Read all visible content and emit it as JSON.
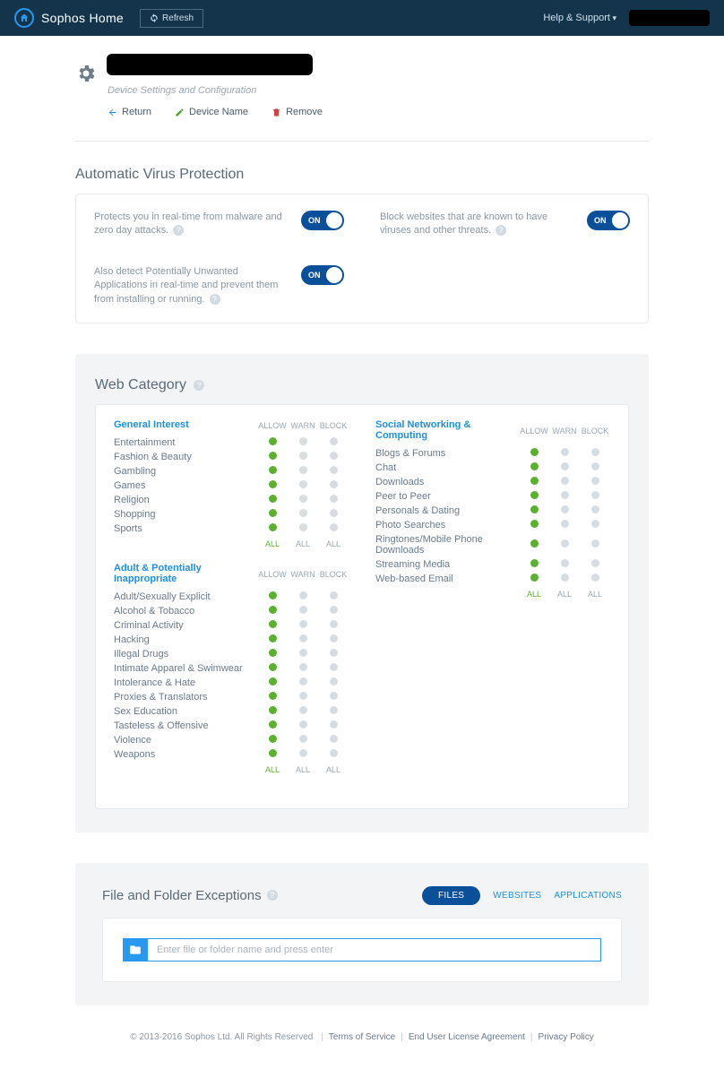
{
  "topbar": {
    "product": "Sophos Home",
    "refresh": "Refresh",
    "help": "Help & Support"
  },
  "device": {
    "subcaption": "Device Settings and Configuration",
    "return": "Return",
    "rename": "Device Name",
    "remove": "Remove"
  },
  "avp": {
    "title": "Automatic Virus Protection",
    "on_label": "ON",
    "items": [
      {
        "text": "Protects you in real-time from malware and zero day attacks."
      },
      {
        "text": "Block websites that are known to have viruses and other threats."
      },
      {
        "text": "Also detect Potentially Unwanted Applications in real-time and prevent them from installing or running."
      }
    ]
  },
  "webcat": {
    "title": "Web Category",
    "col_headers": {
      "allow": "ALLOW",
      "warn": "WARN",
      "block": "BLOCK"
    },
    "all_label": "ALL",
    "left_groups": [
      {
        "name": "General Interest",
        "rows": [
          "Entertainment",
          "Fashion & Beauty",
          "Gambling",
          "Games",
          "Religion",
          "Shopping",
          "Sports"
        ]
      },
      {
        "name": "Adult & Potentially Inappropriate",
        "rows": [
          "Adult/Sexually Explicit",
          "Alcohol & Tobacco",
          "Criminal Activity",
          "Hacking",
          "Illegal Drugs",
          "Intimate Apparel & Swimwear",
          "Intolerance & Hate",
          "Proxies & Translators",
          "Sex Education",
          "Tasteless & Offensive",
          "Violence",
          "Weapons"
        ]
      }
    ],
    "right_groups": [
      {
        "name": "Social Networking & Computing",
        "rows": [
          "Blogs & Forums",
          "Chat",
          "Downloads",
          "Peer to Peer",
          "Personals & Dating",
          "Photo Searches",
          "Ringtones/Mobile Phone Downloads",
          "Streaming Media",
          "Web-based Email"
        ]
      }
    ]
  },
  "exceptions": {
    "title": "File and Folder Exceptions",
    "tabs": [
      "FILES",
      "WEBSITES",
      "APPLICATIONS"
    ],
    "placeholder": "Enter file or folder name and press enter"
  },
  "footer": {
    "copyright": "© 2013-2016 Sophos Ltd.  All Rights Reserved",
    "links": [
      "Terms of Service",
      "End User License Agreement",
      "Privacy Policy"
    ]
  }
}
